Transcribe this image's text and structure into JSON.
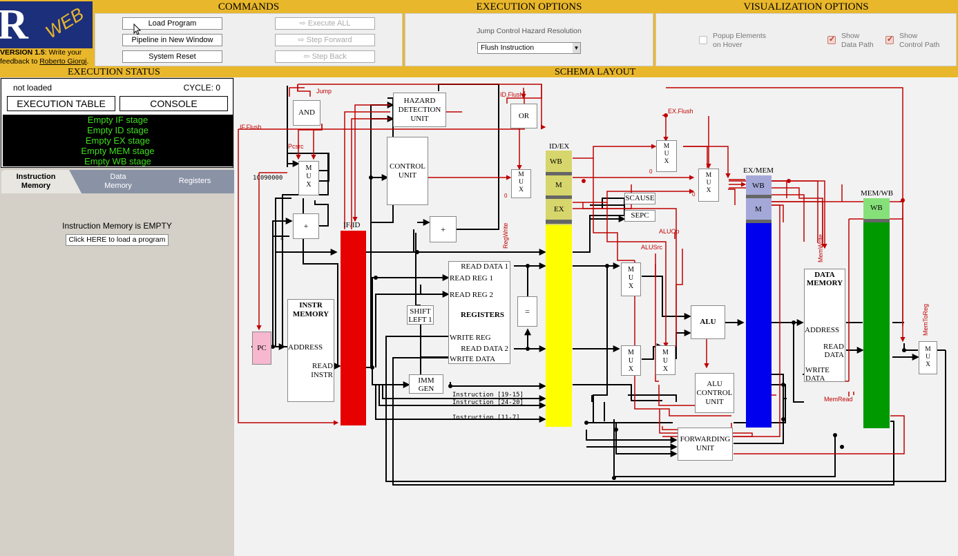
{
  "app": {
    "logo_letter": "R",
    "logo_word": "WEB",
    "version_bold": "VERSION 1.5",
    "version_text": ": Write your feedback to ",
    "version_author": "Roberto Giorgi",
    "version_end": "."
  },
  "commands": {
    "title": "COMMANDS",
    "load_program": "Load Program",
    "pipeline_window": "Pipeline in New Window",
    "system_reset": "System Reset",
    "execute_all": "Execute ALL",
    "step_forward": "Step Forward",
    "step_back": "Step Back"
  },
  "execution_options": {
    "title": "EXECUTION OPTIONS",
    "jump_label": "Jump Control Hazard Resolution",
    "jump_value": "Flush Instruction"
  },
  "visualization_options": {
    "title": "VISUALIZATION OPTIONS",
    "popup_line1": "Popup Elements",
    "popup_line2": "on Hover",
    "datapath_line1": "Show",
    "datapath_line2": "Data Path",
    "control_line1": "Show",
    "control_line2": "Control Path",
    "popup_checked": false,
    "datapath_checked": true,
    "control_checked": true
  },
  "sections": {
    "execution_status": "EXECUTION STATUS",
    "schema_layout": "SCHEMA LAYOUT"
  },
  "status": {
    "state": "not loaded",
    "cycle": "CYCLE: 0",
    "execution_table": "EXECUTION TABLE",
    "console": "CONSOLE",
    "stages": [
      "Empty IF stage",
      "Empty ID stage",
      "Empty EX stage",
      "Empty MEM stage",
      "Empty WB stage"
    ]
  },
  "tabs": {
    "instruction_line1": "Instruction",
    "instruction_line2": "Memory",
    "data_line1": "Data",
    "data_line2": "Memory",
    "registers": "Registers"
  },
  "instruction_memory": {
    "message": "Instruction Memory is EMPTY",
    "load_link": "Click HERE to load a program"
  },
  "schema": {
    "and": "AND",
    "or": "OR",
    "hazard_1": "HAZARD",
    "hazard_2": "DETECTION",
    "hazard_3": "UNIT",
    "control_1": "CONTROL",
    "control_2": "UNIT",
    "mux": [
      "M",
      "U",
      "X"
    ],
    "adder": "+",
    "const_addr": "1C090000",
    "const_4": "4",
    "pc": "PC",
    "instr_mem_1": "INSTR",
    "instr_mem_2": "MEMORY",
    "address": "ADDRESS",
    "read_instr_1": "READ",
    "read_instr_2": "INSTR",
    "if_id": "IF/ID",
    "id_ex": "ID/EX",
    "ex_mem": "EX/MEM",
    "mem_wb": "MEM/WB",
    "wb": "WB",
    "m": "M",
    "ex": "EX",
    "read_data_1": "READ DATA 1",
    "read_reg_1": "READ REG 1",
    "read_reg_2": "READ REG 2",
    "registers": "REGISTERS",
    "write_reg": "WRITE REG",
    "read_data_2": "READ DATA 2",
    "write_data": "WRITE DATA",
    "shift_1": "SHIFT",
    "shift_2": "LEFT 1",
    "equal": "=",
    "imm_1": "IMM",
    "imm_2": "GEN",
    "instr_19_15": "Instruction [19-15]",
    "instr_24_20": "Instruction [24-20]",
    "instr_11_7": "Instruction [11-7]",
    "scause": "SCAUSE",
    "sepc": "SEPC",
    "alu": "ALU",
    "alu_ctrl_1": "ALU",
    "alu_ctrl_2": "CONTROL",
    "alu_ctrl_3": "UNIT",
    "fwd_1": "FORWARDING",
    "fwd_2": "UNIT",
    "data_mem_1": "DATA",
    "data_mem_2": "MEMORY",
    "dm_address": "ADDRESS",
    "dm_read_1": "READ",
    "dm_read_2": "DATA",
    "dm_write_1": "WRITE",
    "dm_write_2": "DATA",
    "zero": "0",
    "sig_jump": "Jump",
    "sig_idflush": "ID.Flush",
    "sig_exflush": "EX.Flush",
    "sig_ifflush": "IF.Flush",
    "sig_pcsrc": "Pcsrc",
    "sig_regwrite": "RegWrite",
    "sig_aluop": "ALUOp",
    "sig_alusrc": "ALUSrc",
    "sig_memwrite": "MemWrite",
    "sig_memread": "MemRead",
    "sig_memtoreg": "MemToReg"
  },
  "colors": {
    "header": "#e9b72b",
    "logo_bg": "#1c2f7a",
    "if_id": "#e60000",
    "id_ex": "#ffff00",
    "ex_mem": "#0000ee",
    "mem_wb": "#009900",
    "pc": "#f7b8cf",
    "stage_text": "#3ee01e",
    "control_wire": "#c00000"
  }
}
